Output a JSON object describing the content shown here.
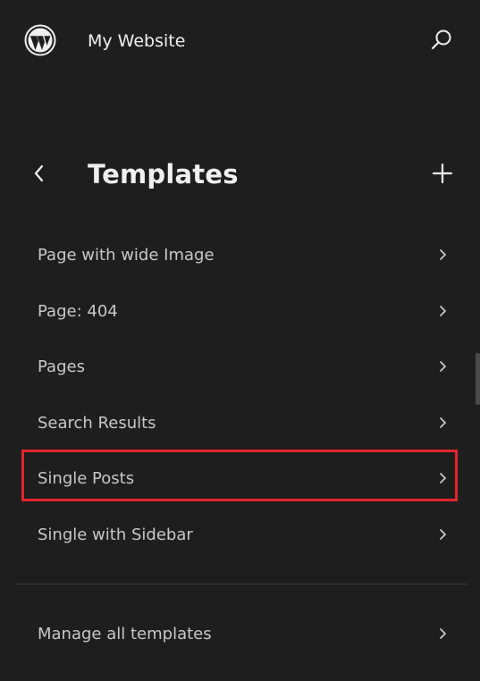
{
  "header": {
    "site_title": "My Website",
    "logo_icon": "wordpress-logo-icon",
    "search_icon": "search-icon"
  },
  "panel": {
    "title": "Templates",
    "back_icon": "chevron-left-icon",
    "add_icon": "plus-icon"
  },
  "templates": [
    {
      "label": "Page with wide Image"
    },
    {
      "label": "Page: 404"
    },
    {
      "label": "Pages"
    },
    {
      "label": "Search Results"
    },
    {
      "label": "Single Posts",
      "highlighted": true
    },
    {
      "label": "Single with Sidebar"
    }
  ],
  "footer": {
    "manage_label": "Manage all templates"
  },
  "colors": {
    "background": "#1e1e1e",
    "highlight": "#e3262b",
    "text": "#c8c8c8"
  }
}
